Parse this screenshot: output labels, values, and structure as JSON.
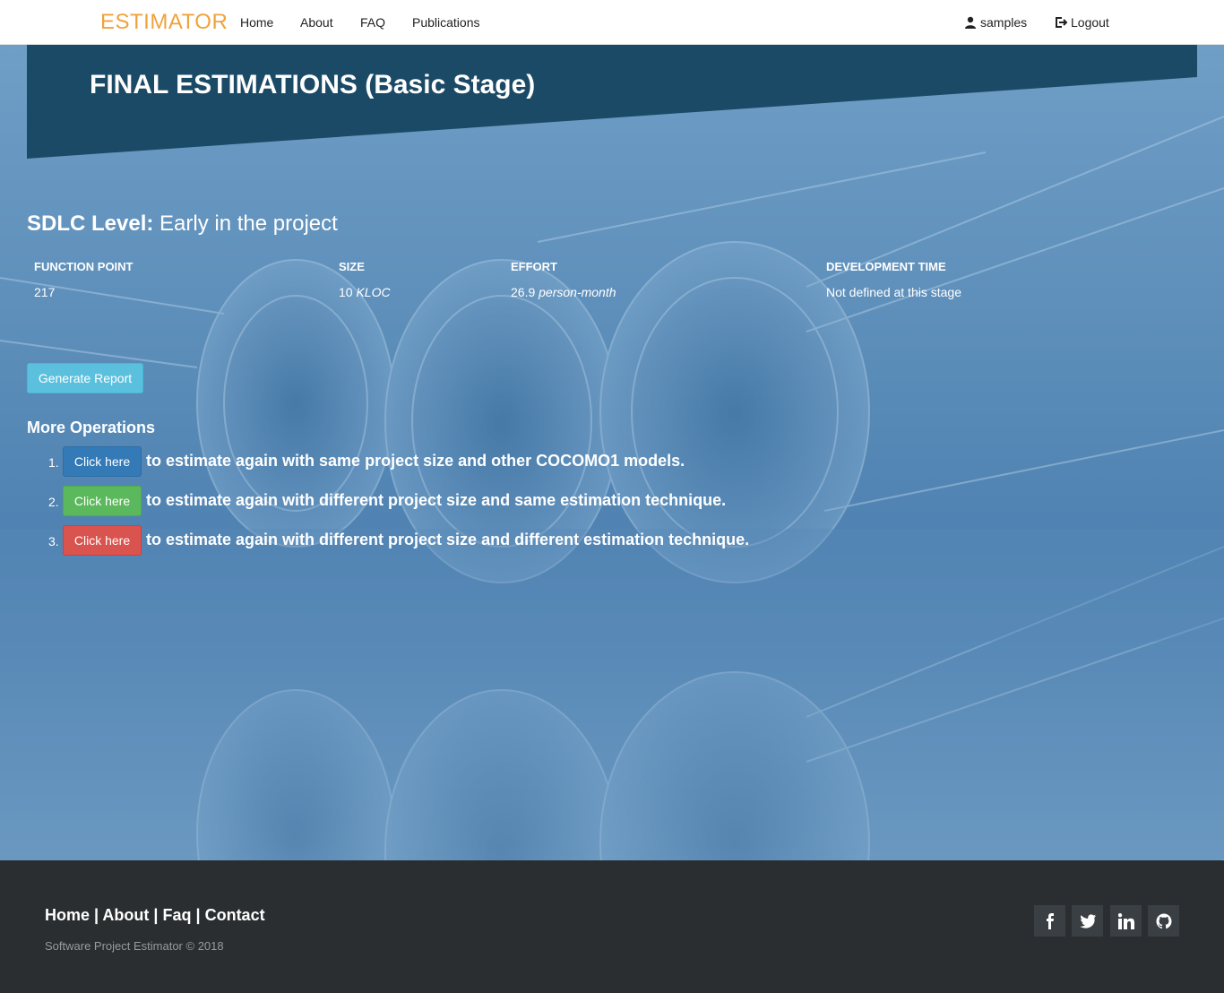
{
  "nav": {
    "brand": "ESTIMATOR",
    "links": [
      "Home",
      "About",
      "FAQ",
      "Publications"
    ],
    "user": "samples",
    "logout": "Logout"
  },
  "hero": {
    "title": "FINAL ESTIMATIONS (Basic Stage)"
  },
  "sdlc": {
    "label": "SDLC Level:",
    "value": "Early in the project"
  },
  "results": {
    "headers": [
      "FUNCTION POINT",
      "SIZE",
      "EFFORT",
      "DEVELOPMENT TIME"
    ],
    "function_point": "217",
    "size_value": "10",
    "size_unit": "KLOC",
    "effort_value": "26.9",
    "effort_unit": "person-month",
    "dev_time": "Not defined at this stage"
  },
  "report_button": "Generate Report",
  "more": {
    "title": "More Operations",
    "items": [
      {
        "num": "1.",
        "button": "Click here",
        "text": "to estimate again with same project size and other COCOMO1 models.",
        "color": "#337ab7"
      },
      {
        "num": "2.",
        "button": "Click here",
        "text": "to estimate again with different project size and same estimation technique.",
        "color": "#5cb85c"
      },
      {
        "num": "3.",
        "button": "Click here",
        "text": "to estimate again with different project size and different estimation technique.",
        "color": "#d9534f"
      }
    ]
  },
  "footer": {
    "links": [
      "Home",
      "About",
      "Faq",
      "Contact"
    ],
    "separator": "|",
    "copyright": "Software Project Estimator © 2018",
    "social_icons": [
      "facebook-icon",
      "twitter-icon",
      "linkedin-icon",
      "github-icon"
    ]
  },
  "colors": {
    "brand": "#f0a23c",
    "hero_bg": "#1b4a66",
    "footer_bg": "#2a2e31"
  }
}
